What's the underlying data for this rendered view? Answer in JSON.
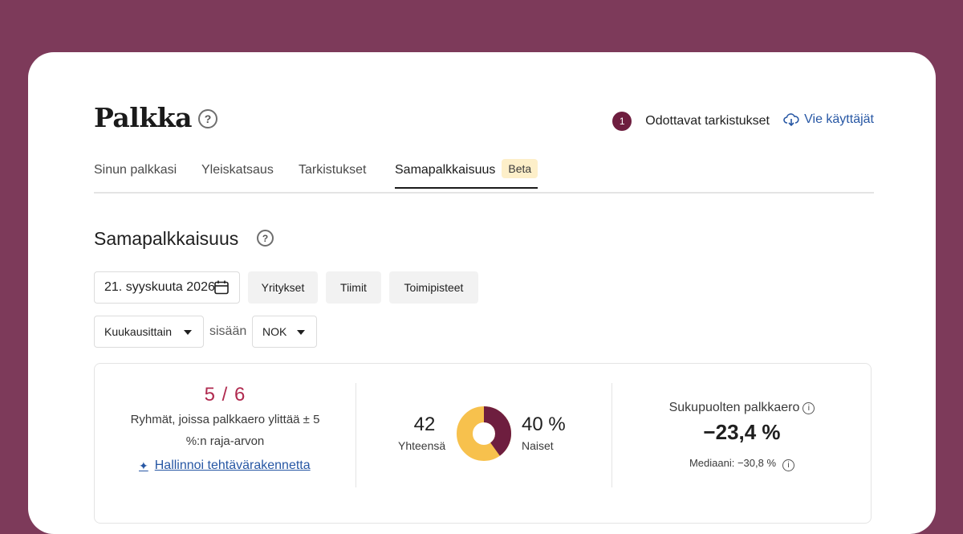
{
  "header": {
    "title": "Palkka",
    "help_icon": "question-circle-icon",
    "pending_count": "1",
    "pending_label": "Odottavat tarkistukset",
    "export_label": "Vie käyttäjät",
    "export_icon": "cloud-download-icon"
  },
  "tabs": [
    {
      "label": "Sinun palkkasi"
    },
    {
      "label": "Yleiskatsaus"
    },
    {
      "label": "Tarkistukset"
    },
    {
      "label": "Samapalkkaisuus",
      "badge": "Beta",
      "active": true
    }
  ],
  "section": {
    "title": "Samapalkkaisuus"
  },
  "filters": {
    "date": "21. syyskuuta 2026",
    "date_icon": "calendar-icon",
    "companies": "Yritykset",
    "teams": "Tiimit",
    "locations": "Toimipisteet",
    "period": "Kuukausittain",
    "within": "sisään",
    "currency": "NOK"
  },
  "stats": {
    "groups_value": "5 / 6",
    "groups_desc": "Ryhmät, joissa palkkaero ylittää ± 5 %:n raja-arvon",
    "manage_link": "Hallinnoi tehtävärakennetta",
    "manage_icon": "sparkle-icon",
    "total_value": "42",
    "total_label": "Yhteensä",
    "women_value": "40 %",
    "women_label": "Naiset",
    "women_fraction": 0.4,
    "gap_title": "Sukupuolten palkkaero",
    "gap_value": "−23,4 %",
    "median": "Mediaani: −30,8 %",
    "info_icon": "info-circle-icon"
  },
  "colors": {
    "background": "#7d3a5a",
    "women_segment": "#6e1e3f",
    "men_segment": "#f7c14d",
    "accent_value": "#b02a4f",
    "link": "#2757a4",
    "beta_badge": "#fdefc9"
  }
}
